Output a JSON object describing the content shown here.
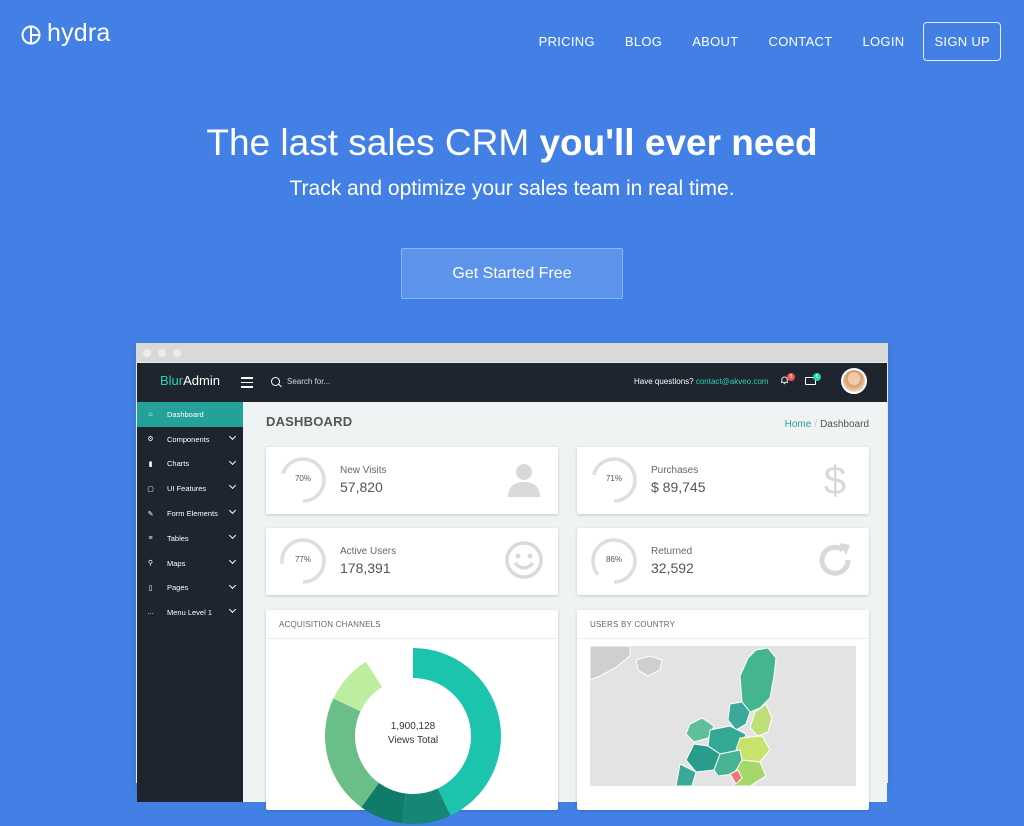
{
  "brand": {
    "name": "hydra"
  },
  "nav": {
    "links": [
      "PRICING",
      "BLOG",
      "ABOUT",
      "CONTACT",
      "LOGIN"
    ],
    "signup": "SIGN UP"
  },
  "hero": {
    "title_plain": "The last sales CRM ",
    "title_bold": "you'll ever need",
    "subtitle": "Track and optimize your sales team in real time.",
    "cta": "Get Started Free"
  },
  "app": {
    "brand_blur": "Blur",
    "brand_admin": "Admin",
    "search_placeholder": "Search for...",
    "question": "Have questions?",
    "email": "contact@akveo.com",
    "notif_count": "5",
    "msg_count": "5",
    "sidebar": [
      {
        "label": "Dashboard",
        "icon": "home-icon",
        "glyph": "⌂",
        "active": true,
        "chevron": false
      },
      {
        "label": "Components",
        "icon": "gear-icon",
        "glyph": "⚙",
        "active": false,
        "chevron": true
      },
      {
        "label": "Charts",
        "icon": "bar-chart-icon",
        "glyph": "▮",
        "active": false,
        "chevron": true
      },
      {
        "label": "UI Features",
        "icon": "monitor-icon",
        "glyph": "▢",
        "active": false,
        "chevron": true
      },
      {
        "label": "Form Elements",
        "icon": "edit-icon",
        "glyph": "✎",
        "active": false,
        "chevron": true
      },
      {
        "label": "Tables",
        "icon": "table-icon",
        "glyph": "≡",
        "active": false,
        "chevron": true
      },
      {
        "label": "Maps",
        "icon": "map-pin-icon",
        "glyph": "⚲",
        "active": false,
        "chevron": true
      },
      {
        "label": "Pages",
        "icon": "page-icon",
        "glyph": "▯",
        "active": false,
        "chevron": true
      },
      {
        "label": "Menu Level 1",
        "icon": "ellipsis-icon",
        "glyph": "…",
        "active": false,
        "chevron": true
      }
    ],
    "page_title": "DASHBOARD",
    "breadcrumb": {
      "home": "Home",
      "current": "Dashboard"
    },
    "stats": [
      {
        "label": "New Visits",
        "value": "57,820",
        "percent": "70%",
        "fraction": 0.7,
        "icon": "person-icon"
      },
      {
        "label": "Purchases",
        "value": "$ 89,745",
        "percent": "71%",
        "fraction": 0.71,
        "icon": "dollar-icon"
      },
      {
        "label": "Active Users",
        "value": "178,391",
        "percent": "77%",
        "fraction": 0.77,
        "icon": "smiley-icon"
      },
      {
        "label": "Returned",
        "value": "32,592",
        "percent": "86%",
        "fraction": 0.86,
        "icon": "refresh-icon"
      }
    ],
    "acquisition": {
      "title": "ACQUISITION CHANNELS",
      "total": "1,900,128",
      "total_label": "Views Total",
      "segments": [
        {
          "fraction": 0.43,
          "color": "#1cc4ad"
        },
        {
          "fraction": 0.09,
          "color": "#168774"
        },
        {
          "fraction": 0.08,
          "color": "#0f7c6a"
        },
        {
          "fraction": 0.22,
          "color": "#6abf88"
        },
        {
          "fraction": 0.09,
          "color": "#bdeea0"
        }
      ]
    },
    "country": {
      "title": "USERS BY COUNTRY"
    }
  },
  "colors": {
    "background": "#4380e6",
    "accent": "#24a29a",
    "dark": "#1e252e"
  }
}
